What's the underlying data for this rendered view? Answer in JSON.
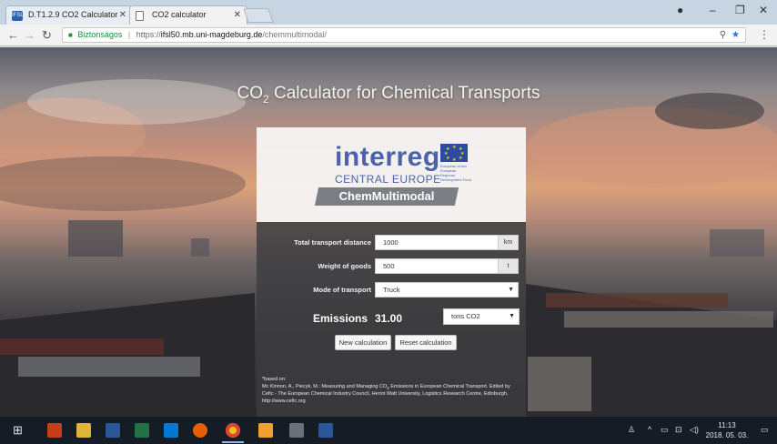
{
  "browser": {
    "tabs": [
      {
        "label": "D.T1.2.9 CO2 Calculator",
        "favicon": "ifsl-icon"
      },
      {
        "label": "CO2 calculator",
        "favicon": "page-icon"
      }
    ],
    "address": {
      "security_label": "Biztonságos",
      "protocol": "https://",
      "host": "ifsl50.mb.uni-magdeburg.de",
      "path": "/chemmultimodal/"
    }
  },
  "page": {
    "title_prefix": "CO",
    "title_sub": "2",
    "title_suffix": " Calculator for Chemical Transports",
    "logo": {
      "word": "interreg",
      "sub": "CENTRAL EUROPE",
      "eu_text": "European Union European Regional Development Fund",
      "project": "ChemMultimodal"
    },
    "form": {
      "distance_label": "Total transport distance",
      "distance_value": "1000",
      "distance_unit": "km",
      "weight_label": "Weight of goods",
      "weight_value": "500",
      "weight_unit": "t",
      "mode_label": "Mode of transport",
      "mode_value": "Truck",
      "emissions_label": "Emissions",
      "emissions_value": "31.00",
      "emissions_unit": "tons CO2",
      "new_button": "New calculation",
      "reset_button": "Reset calculation"
    },
    "reference": {
      "based_on": "*based on:",
      "citation_a": "Mc Kinnon, A., Piecyk, M.: Measuring and Managing CO",
      "citation_sub": "2",
      "citation_b": " Emissions in European Chemical Transport. Edited by Cefic - The European Chemical Industry Council, Heriot Watt University, Logistics Research Centre, Edinburgh. http://www.cefic.org"
    }
  },
  "taskbar": {
    "time": "11:13",
    "date": "2018. 05. 03."
  }
}
